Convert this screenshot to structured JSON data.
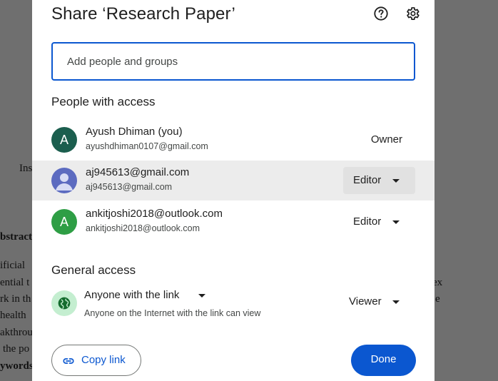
{
  "background_document": {
    "fragments": [
      {
        "text": "Insi"
      },
      {
        "text": "bstract"
      },
      {
        "text": "ificial"
      },
      {
        "text": "ential t"
      },
      {
        "text": "rk in th"
      },
      {
        "text": "health"
      },
      {
        "text": "akthrou"
      },
      {
        "text": "the po"
      },
      {
        "text": "ywords"
      },
      {
        "text": "ex"
      },
      {
        "text": "e"
      }
    ]
  },
  "dialog": {
    "title": "Share ‘Research Paper’",
    "help_icon": "help-circle-icon",
    "settings_icon": "gear-icon",
    "add_people": {
      "placeholder": "Add people and groups",
      "value": ""
    },
    "people_heading": "People with access",
    "people": [
      {
        "name": "Ayush Dhiman (you)",
        "email": "ayushdhiman0107@gmail.com",
        "avatar_letter": "A",
        "avatar_color": "#1b5e4e",
        "role": "Owner"
      },
      {
        "name": "aj945613@gmail.com",
        "email": "aj945613@gmail.com",
        "avatar_letter": "",
        "avatar_color": "#5c6bc0",
        "role": "Editor"
      },
      {
        "name": "ankitjoshi2018@outlook.com",
        "email": "ankitjoshi2018@outlook.com",
        "avatar_letter": "A",
        "avatar_color": "#2e9e45",
        "role": "Editor"
      }
    ],
    "general_access": {
      "heading": "General access",
      "icon": "globe-icon",
      "link_setting": "Anyone with the link",
      "description": "Anyone on the Internet with the link can view",
      "role": "Viewer"
    },
    "copy_link_label": "Copy link",
    "done_label": "Done",
    "colors": {
      "accent": "#0b57d0",
      "ga_icon_bg": "#c4eed0",
      "ga_icon_fg": "#146c2e"
    }
  }
}
